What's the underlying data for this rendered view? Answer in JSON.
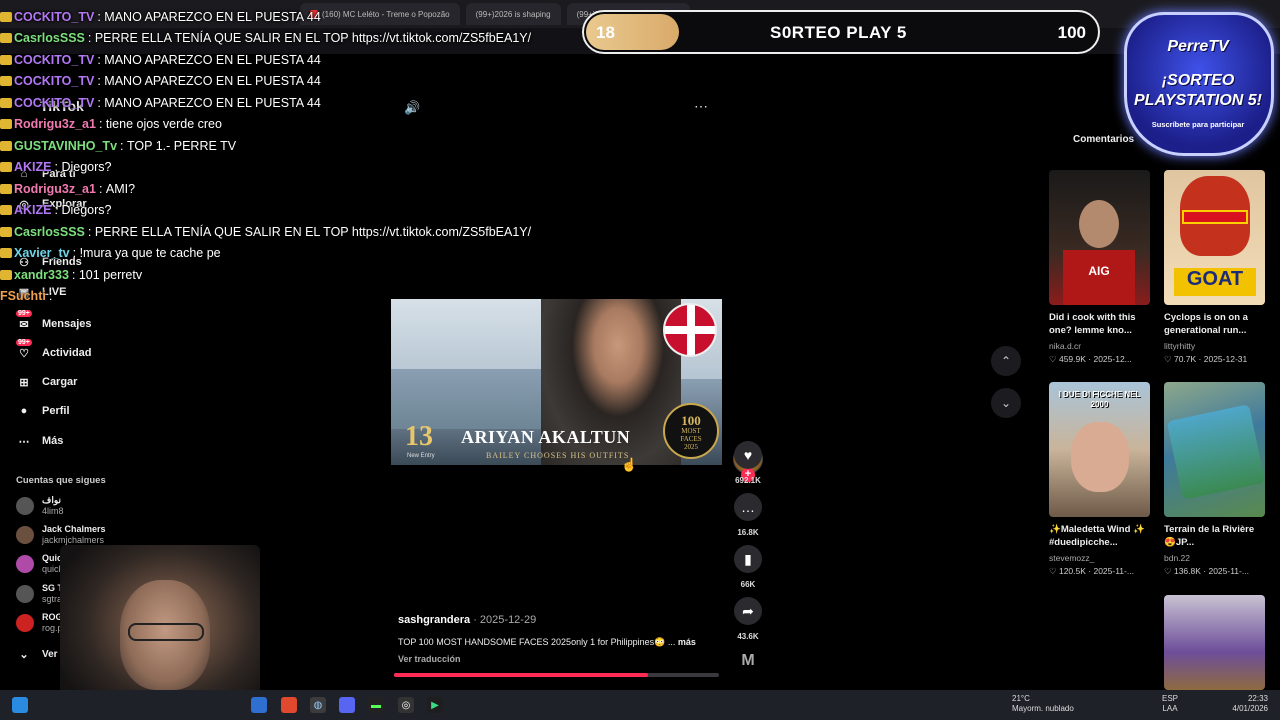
{
  "browser": {
    "tabs": [
      {
        "title": "(160) MC Leléto - Treme o Popozão"
      },
      {
        "title": "(99+)2026 is shaping"
      },
      {
        "title": "(99+)Top 100 Most Handsom"
      }
    ]
  },
  "tiktok": {
    "logo": "TikTok",
    "nav": [
      {
        "label": "Para ti",
        "icon": "home-icon"
      },
      {
        "label": "Explorar",
        "icon": "compass-icon"
      },
      {
        "label": "Friends",
        "icon": "friends-icon"
      },
      {
        "label": "LIVE",
        "icon": "live-icon"
      },
      {
        "label": "Mensajes",
        "icon": "message-icon",
        "badge": "99+"
      },
      {
        "label": "Actividad",
        "icon": "activity-icon",
        "badge": "99+"
      },
      {
        "label": "Cargar",
        "icon": "upload-icon"
      },
      {
        "label": "Perfil",
        "icon": "profile-icon"
      },
      {
        "label": "Más",
        "icon": "more-icon"
      }
    ],
    "following_title": "Cuentas que sigues",
    "following": [
      {
        "name": "نواف",
        "handle": "4lim8"
      },
      {
        "name": "Jack Chalmers",
        "handle": "jackmjchalmers"
      },
      {
        "name": "QuickQuizGo",
        "handle": "quickquizgo"
      },
      {
        "name": "SG TRAS",
        "handle": "sgtrash_"
      },
      {
        "name": "ROG Pe",
        "handle": "rog.pe"
      }
    ],
    "see_more": "Ver más",
    "video": {
      "rank": "13",
      "new_entry": "New Entry",
      "name": "ARIYAN AKALTUN",
      "sub": "BAILEY CHOOSES HIS OUTFITS",
      "seal_top": "100",
      "seal_mid": "MOST",
      "seal_bottom": "FACES",
      "seal_year": "2025"
    },
    "actions": {
      "likes": "692.1K",
      "comments": "16.8K",
      "saves": "66K",
      "shares": "43.6K"
    },
    "caption": {
      "author": "sashgrandera",
      "date": " · 2025-12-29",
      "text": "TOP 100 MOST HANDSOME FACES 2025only 1 for Philippines😳 ... ",
      "more": "más",
      "translate": "Ver traducción"
    },
    "progress": 0.78,
    "comments_tab": "Comentarios",
    "related": [
      {
        "title": "Did i cook with this one? lemme kno...",
        "author": "nika.d.cr",
        "stats": "♡ 459.9K · 2025-12..."
      },
      {
        "title": "Cyclops is on on a generational run...",
        "author": "littyrhitty",
        "stats": "♡ 70.7K · 2025-12-31"
      },
      {
        "title": "✨Maledetta Wind ✨ #duedipicche...",
        "author": "stevemozz_",
        "stats": "♡ 120.5K · 2025-11-..."
      },
      {
        "title": "Terrain de la Rivière😍JP...",
        "author": "bdn.22",
        "stats": "♡ 136.8K · 2025-11-..."
      }
    ],
    "thumb_texts": {
      "goat": "GOAT",
      "aig": "AIG",
      "ficche": "I DUE DI FICCHE NEL 2000"
    }
  },
  "chat": [
    {
      "user": "COCKITO_TV",
      "msg": "MANO APAREZCO EN EL PUESTA 44",
      "color": "#b278f5"
    },
    {
      "user": "CasrlosSSS",
      "msg": "PERRE ELLA TENÍA QUE SALIR EN EL TOP https://vt.tiktok.com/ZS5fbEA1Y/",
      "color": "#7de07d"
    },
    {
      "user": "COCKITO_TV",
      "msg": "MANO APAREZCO EN EL PUESTA 44",
      "color": "#b278f5"
    },
    {
      "user": "COCKITO_TV",
      "msg": "MANO APAREZCO EN EL PUESTA 44",
      "color": "#b278f5"
    },
    {
      "user": "COCKITO_TV",
      "msg": "MANO APAREZCO EN EL PUESTA 44",
      "color": "#b278f5"
    },
    {
      "user": "Rodrigu3z_a1",
      "msg": "tiene ojos verde creo",
      "color": "#f07ab0"
    },
    {
      "user": "GUSTAVINHO_Tv",
      "msg": "TOP 1.- PERRE TV",
      "color": "#7de07d"
    },
    {
      "user": "AKIZE",
      "msg": "Diegors?",
      "color": "#b278f5"
    },
    {
      "user": "Rodrigu3z_a1",
      "msg": "AMI?",
      "color": "#f07ab0"
    },
    {
      "user": "AKIZE",
      "msg": "Diegors?",
      "color": "#b278f5"
    },
    {
      "user": "CasrlosSSS",
      "msg": "PERRE ELLA TENÍA QUE SALIR EN EL TOP https://vt.tiktok.com/ZS5fbEA1Y/",
      "color": "#7de07d"
    },
    {
      "user": "Xavier_tv",
      "msg": "!mura ya que te cache pe",
      "color": "#6fd6e8"
    },
    {
      "user": "xandr333",
      "msg": "101 perretv",
      "color": "#7de07d"
    },
    {
      "user": "FSuchti",
      "msg": "",
      "color": "#f0a050"
    }
  ],
  "overlay": {
    "left_number": "18",
    "title": "S0RTEO PLAY 5",
    "right_number": "100",
    "progress": 0.18,
    "promo_brand": "PerreTV",
    "promo_line1": "¡SORTEO",
    "promo_line2": "PLAYSTATION 5!",
    "promo_sub": "Suscríbete para participar"
  },
  "taskbar": {
    "temp": "21°C",
    "weather": "Mayorm. nublado",
    "lang": "ESP",
    "lang2": "LAA",
    "time": "22:33",
    "date": "4/01/2026"
  },
  "colors": {
    "accent": "#fe2c55",
    "background": "#000000"
  }
}
